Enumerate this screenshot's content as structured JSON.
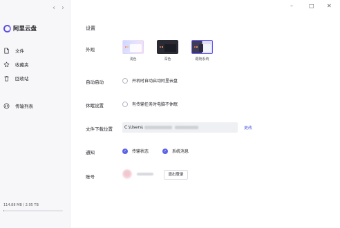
{
  "window": {
    "controls": {
      "minimize": "–",
      "maximize": "□",
      "close": "✕"
    }
  },
  "sidebar": {
    "nav_back": "‹",
    "nav_forward": "›",
    "brand_name": "阿里云盘",
    "items": [
      {
        "label": "文件",
        "icon": "file-icon"
      },
      {
        "label": "收藏夹",
        "icon": "star-icon"
      },
      {
        "label": "回收站",
        "icon": "trash-icon"
      },
      {
        "label": "传输列表",
        "icon": "transfer-icon"
      }
    ],
    "storage": {
      "text": "114.88 MB / 2.95 TB",
      "used_fraction": 0.01
    }
  },
  "settings": {
    "title": "设置",
    "appearance": {
      "label": "外观",
      "options": [
        {
          "label": "浅色",
          "selected": false
        },
        {
          "label": "深色",
          "selected": false
        },
        {
          "label": "跟随系统",
          "selected": true
        }
      ]
    },
    "autostart": {
      "label": "自动启动",
      "option": "开机时自动启动阿里云盘",
      "checked": false
    },
    "sleep": {
      "label": "休眠设置",
      "option": "有传输任务时电脑不休眠",
      "checked": false
    },
    "download": {
      "label": "文件下载位置",
      "path_prefix": "C:\\Users\\",
      "change": "更改"
    },
    "notify": {
      "label": "通知",
      "options": [
        {
          "label": "传输状态",
          "checked": true
        },
        {
          "label": "系统消息",
          "checked": true
        }
      ]
    },
    "account": {
      "label": "账号",
      "logout": "退出登录"
    }
  },
  "colors": {
    "accent": "#5b63e6",
    "sidebar_bg": "#f7f7f9"
  }
}
